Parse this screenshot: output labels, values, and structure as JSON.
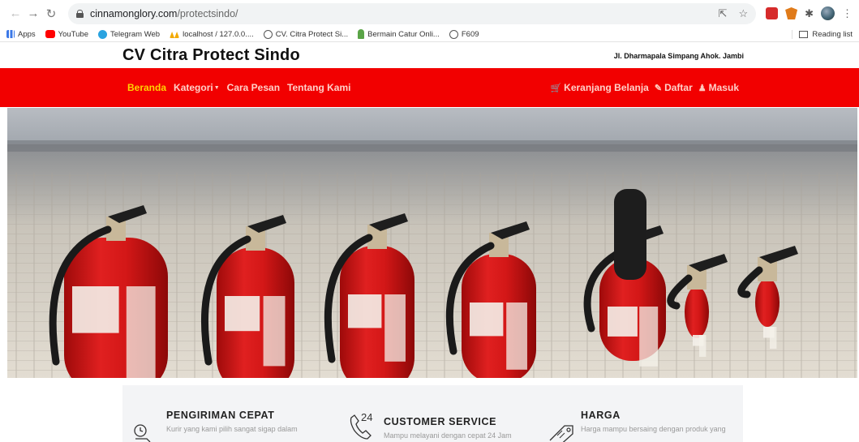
{
  "browser": {
    "url_domain": "cinnamonglory.com",
    "url_path": "/protectsindo/",
    "bookmarks": [
      {
        "label": "Apps",
        "icon": "apps-icon"
      },
      {
        "label": "YouTube",
        "icon": "youtube-icon"
      },
      {
        "label": "Telegram Web",
        "icon": "telegram-icon"
      },
      {
        "label": "localhost / 127.0.0....",
        "icon": "phpmyadmin-icon"
      },
      {
        "label": "CV. Citra Protect Si...",
        "icon": "globe-icon"
      },
      {
        "label": "Bermain Catur Onli...",
        "icon": "chess-icon"
      },
      {
        "label": "F609",
        "icon": "globe-icon"
      }
    ],
    "reading_list": "Reading list"
  },
  "site": {
    "brand": "CV Citra Protect Sindo",
    "address": "Jl. Dharmapala Simpang Ahok. Jambi",
    "colors": {
      "navbar": "#f20000",
      "active": "#ffd400"
    }
  },
  "nav": {
    "left": [
      {
        "label": "Beranda",
        "active": true
      },
      {
        "label": "Kategori",
        "dropdown": true
      },
      {
        "label": "Cara Pesan"
      },
      {
        "label": "Tentang Kami"
      }
    ],
    "right": [
      {
        "label": "Keranjang Belanja",
        "icon": "cart-icon"
      },
      {
        "label": "Daftar",
        "icon": "edit-icon"
      },
      {
        "label": "Masuk",
        "icon": "user-icon"
      }
    ]
  },
  "hero": {
    "image": "fire-extinguishers-photo"
  },
  "features": [
    {
      "title": "PENGIRIMAN CEPAT",
      "desc": "Kurir yang kami pilih sangat sigap dalam",
      "icon": "delivery-icon"
    },
    {
      "title": "CUSTOMER SERVICE",
      "desc": "Mampu melayani dengan cepat 24 Jam",
      "icon": "phone-24-icon",
      "icon_text": "24"
    },
    {
      "title": "HARGA",
      "desc": "Harga mampu bersaing dengan produk yang",
      "icon": "price-tag-icon"
    }
  ]
}
